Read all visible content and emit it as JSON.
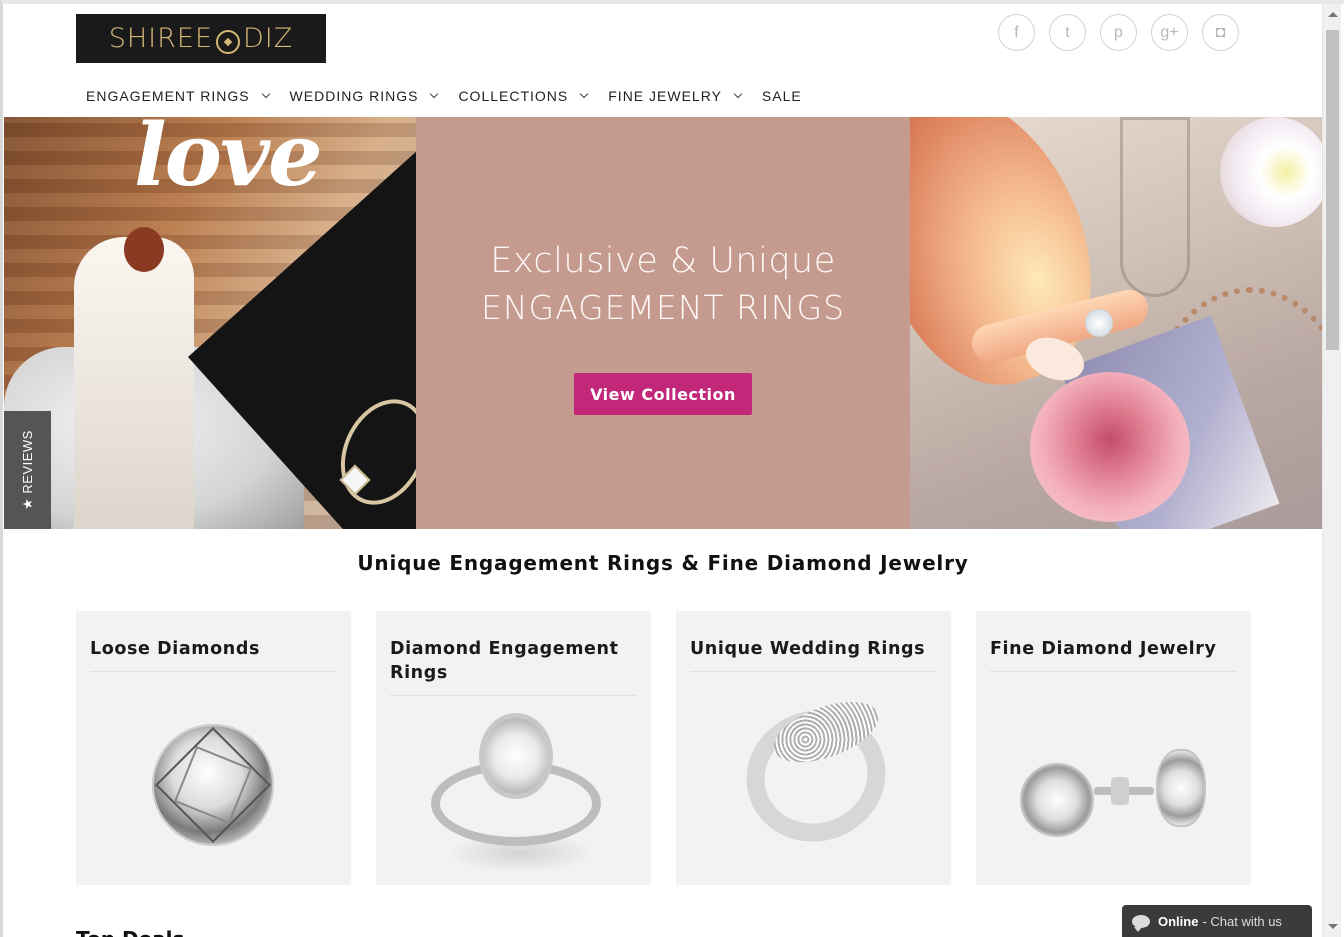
{
  "header": {
    "logo_left": "SHIREE",
    "logo_right": "DIZ",
    "social": [
      {
        "icon": "facebook-icon",
        "glyph": "f"
      },
      {
        "icon": "twitter-icon",
        "glyph": "t"
      },
      {
        "icon": "pinterest-icon",
        "glyph": "p"
      },
      {
        "icon": "google-plus-icon",
        "glyph": "g+"
      },
      {
        "icon": "instagram-icon",
        "glyph": "◘"
      }
    ]
  },
  "nav": {
    "items": [
      {
        "label": "ENGAGEMENT RINGS",
        "has_dropdown": true
      },
      {
        "label": "WEDDING RINGS",
        "has_dropdown": true
      },
      {
        "label": "COLLECTIONS",
        "has_dropdown": true
      },
      {
        "label": "FINE JEWELRY",
        "has_dropdown": true
      },
      {
        "label": "SALE",
        "has_dropdown": false
      }
    ]
  },
  "hero": {
    "left_overlay_text": "love",
    "headline_line1": "Exclusive & Unique",
    "headline_line2": "ENGAGEMENT RINGS",
    "cta_label": "View Collection",
    "reviews_tab": "★ REVIEWS",
    "colors": {
      "panel": "#c69b8f",
      "cta": "#c2277a"
    }
  },
  "section": {
    "title": "Unique Engagement Rings & Fine Diamond Jewelry",
    "next_heading": "Top Deals"
  },
  "categories": [
    {
      "title": "Loose Diamonds",
      "image": "loose-diamond-image"
    },
    {
      "title": "Diamond Engagement Rings",
      "image": "engagement-ring-image"
    },
    {
      "title": "Unique Wedding Rings",
      "image": "wedding-ring-image"
    },
    {
      "title": "Fine Diamond Jewelry",
      "image": "earrings-image"
    }
  ],
  "chat": {
    "status": "Online",
    "message": "- Chat with us"
  }
}
